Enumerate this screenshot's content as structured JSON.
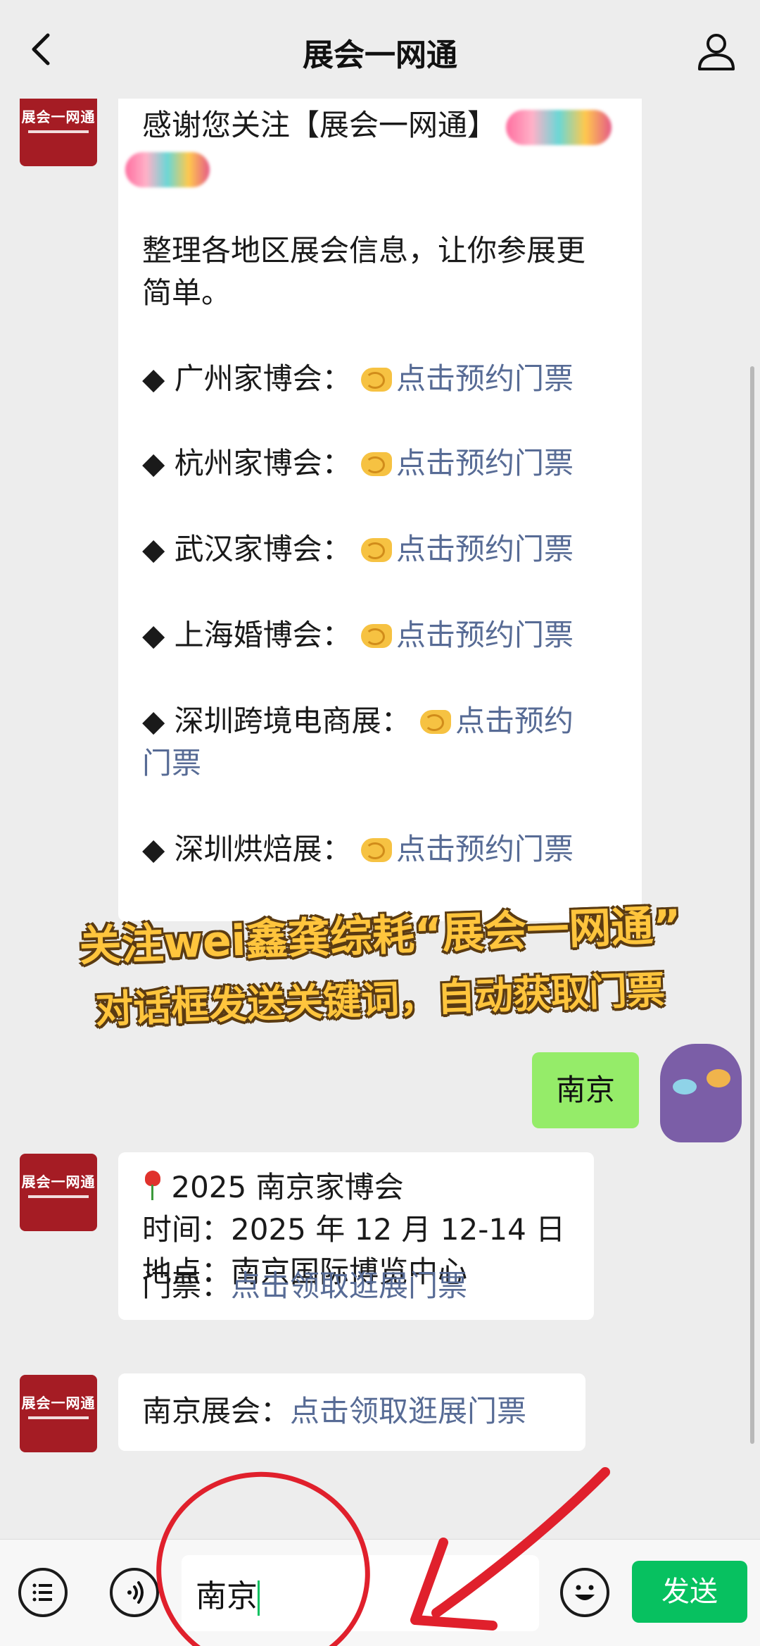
{
  "header": {
    "title": "展会一网通"
  },
  "brand": {
    "avatar_text": "展会一网通"
  },
  "welcome": {
    "intro": "感谢您关注【展会一网通】",
    "subtitle_lines": [
      "整理各地区展会信息，让你参展更",
      "简单。"
    ],
    "items": [
      {
        "bullet": "◆",
        "name": "广州家博会：",
        "link": "点击预约门票"
      },
      {
        "bullet": "◆",
        "name": "杭州家博会：",
        "link": "点击预约门票"
      },
      {
        "bullet": "◆",
        "name": "武汉家博会：",
        "link": "点击预约门票"
      },
      {
        "bullet": "◆",
        "name": "上海婚博会：",
        "link": "点击预约门票"
      },
      {
        "bullet": "◆",
        "name": "深圳跨境电商展：",
        "link_a": "点击预约",
        "link_b": "门票"
      },
      {
        "bullet": "◆",
        "name": "深圳烘焙展：",
        "link": "点击预约门票"
      }
    ]
  },
  "overlay": {
    "line1": "关注wei鑫龚综耗“展会一网通”",
    "line2": "对话框发送关键词，自动获取门票"
  },
  "user_message": {
    "text": "南京"
  },
  "reply1": {
    "title": "2025 南京家博会",
    "time_label": "时间：",
    "time_value": "2025 年 12 月 12-14 日",
    "place_label": "地点：",
    "place_value": "南京国际博览中心",
    "ticket_label": "门票：",
    "ticket_link": "点击领取逛展门票"
  },
  "reply2": {
    "label": "南京展会：",
    "link": "点击领取逛展门票"
  },
  "input": {
    "value": "南京"
  },
  "send_label": "发送"
}
